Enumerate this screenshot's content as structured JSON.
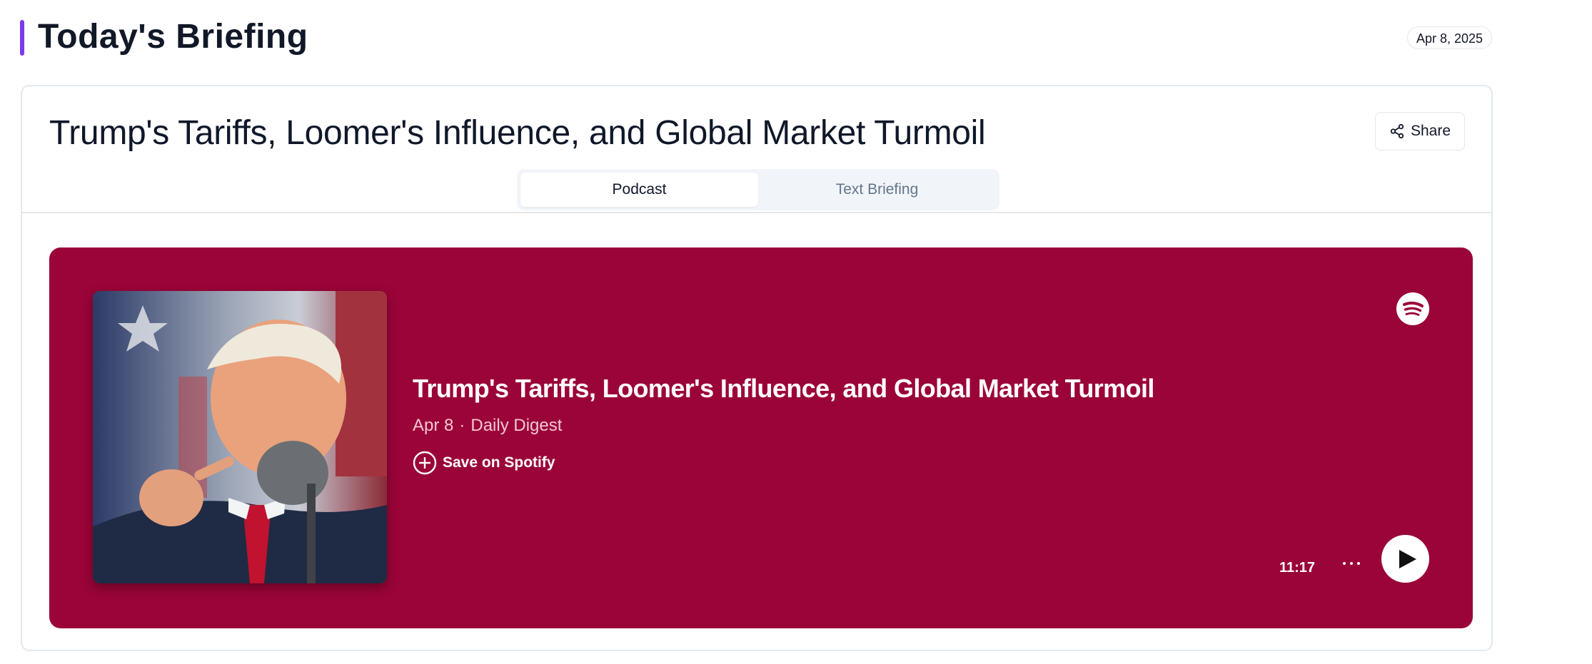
{
  "header": {
    "title": "Today's Briefing",
    "date": "Apr 8, 2025"
  },
  "briefing": {
    "title": "Trump's Tariffs, Loomer's Influence, and Global Market Turmoil",
    "share_label": "Share",
    "tabs": [
      {
        "label": "Podcast",
        "active": true
      },
      {
        "label": "Text Briefing",
        "active": false
      }
    ]
  },
  "player": {
    "background_color": "#9b0438",
    "episode_title": "Trump's Tariffs, Loomer's Influence, and Global Market Turmoil",
    "episode_date": "Apr 8",
    "separator": "·",
    "show_name": "Daily Digest",
    "save_label": "Save on Spotify",
    "duration": "11:17",
    "icons": [
      "spotify-logo",
      "plus-circle-icon",
      "more-icon",
      "play-icon"
    ]
  },
  "colors": {
    "accent": "#7c3aed",
    "player_bg": "#9b0438"
  }
}
